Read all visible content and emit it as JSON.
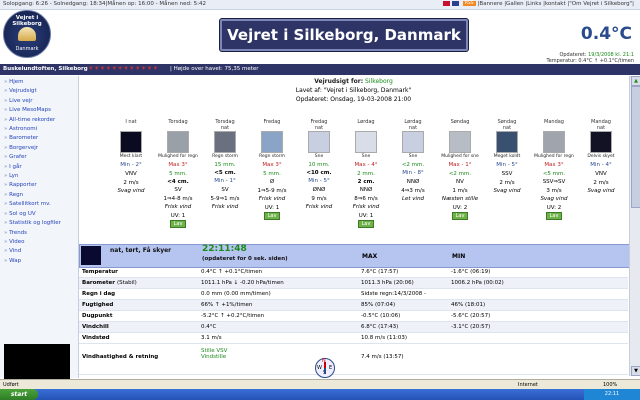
{
  "topstrip": {
    "left_text": "Solopgang: 6:26 - Solnedgang: 18:34|Månen op: 16:00 - Månen ned: 5:42",
    "rss_label": "RSS",
    "links": "|Bannere |Gallen |Links |kontakt  |\"Om Vejret i Silkeborg\"|"
  },
  "header": {
    "logo_top": "Vejret i Silkeborg",
    "logo_bottom": "Danmark",
    "title": "Vejret i Silkeborg, Danmark",
    "big_temp": "0.4°C",
    "updated_line1_pre": "Opdateret: ",
    "updated_line1": "19/3/2008 kl. 21:1",
    "updated_line2": "Temperatur: 0.4°C ↑ +0.1°C/timen"
  },
  "locbar": {
    "name": "Buskelundtoften, Silkeborg",
    "dots": "☀☀☀☀☀☀☀☀☀☀☀☀",
    "altitude": "| Højde over havet: 75,35 meter"
  },
  "sidebar": {
    "items": [
      "Hjem",
      "Vejrudsigt",
      "Live vejr",
      "Live MesoMaps",
      "All-time rekorder",
      "Astronomi",
      "Barometer",
      "Borgervejr",
      "Grafer",
      "I går",
      "Lyn",
      "Rapporter",
      "Regn",
      "Satellitkort mv.",
      "Sol og UV",
      "Statistik og logfiler",
      "Trends",
      "Video",
      "Vind",
      "Wap"
    ]
  },
  "forecast": {
    "title_prefix": "Vejrudsigt for:",
    "title_place": "Silkeborg",
    "made_by": "Lavet af: \"Vejret i Silkeborg, Danmark\"",
    "updated": "Opdateret: Onsdag, 19-03-2008 21:00",
    "days": [
      {
        "day": "I nat",
        "desc": "Mest klart",
        "max": "",
        "mm": "",
        "snow": "",
        "min": "Min - 2°",
        "wind_dir": "VNV",
        "wind_speed": "2 m/s",
        "wind_text": "Svag vind",
        "uv": "",
        "uv_level": ""
      },
      {
        "day": "Torsdag",
        "desc": "Mulighed for regn",
        "max": "Max 3°",
        "mm": "5 mm.",
        "snow": "<4 cm.",
        "min": "",
        "wind_dir": "SV",
        "wind_speed": "1⇒4-8 m/s",
        "wind_text": "Frisk vind",
        "uv": "UV: 1",
        "uv_level": "Lav"
      },
      {
        "day": "Torsdag\nnat",
        "desc": "Regn storm",
        "max": "",
        "mm": "15 mm.",
        "snow": "<5 cm.",
        "min": "Min - 1°",
        "wind_dir": "SV",
        "wind_speed": "5-9⇒1 m/s",
        "wind_text": "Frisk vind",
        "uv": "",
        "uv_level": ""
      },
      {
        "day": "Fredag",
        "desc": "Regn storm",
        "max": "Max 3°",
        "mm": "5 mm.",
        "snow": "",
        "min": "",
        "wind_dir": "Ø",
        "wind_speed": "1⇒5-9 m/s",
        "wind_text": "Frisk vind",
        "uv": "UV: 1",
        "uv_level": "Lav"
      },
      {
        "day": "Fredag\nnat",
        "desc": "Sne",
        "max": "",
        "mm": "10 mm.",
        "snow": "<10 cm.",
        "min": "Min - 5°",
        "wind_dir": "ØNØ",
        "wind_speed": "9 m/s",
        "wind_text": "Frisk vind",
        "uv": "",
        "uv_level": ""
      },
      {
        "day": "Lørdag",
        "desc": "Sne",
        "max": "Max - 4°",
        "mm": "2 mm.",
        "snow": "2 cm.",
        "min": "",
        "wind_dir": "NNØ",
        "wind_speed": "8⇒6 m/s",
        "wind_text": "Frisk vind",
        "uv": "UV: 1",
        "uv_level": "Lav"
      },
      {
        "day": "Lørdag\nnat",
        "desc": "Sne",
        "max": "",
        "mm": "<2 mm.",
        "snow": "",
        "min": "Min - 8°",
        "wind_dir": "NNØ",
        "wind_speed": "4⇒3 m/s",
        "wind_text": "Let vind",
        "uv": "",
        "uv_level": ""
      },
      {
        "day": "Søndag",
        "desc": "Mulighed for sne",
        "max": "Max - 1°",
        "mm": "<2 mm.",
        "snow": "",
        "min": "",
        "wind_dir": "NV",
        "wind_speed": "1 m/s",
        "wind_text": "Næsten stille",
        "uv": "UV: 2",
        "uv_level": "Lav"
      },
      {
        "day": "Søndag\nnat",
        "desc": "Meget koldt",
        "max": "",
        "mm": "",
        "snow": "",
        "min": "Min - 5°",
        "wind_dir": "SSV",
        "wind_speed": "2 m/s",
        "wind_text": "Svag vind",
        "uv": "",
        "uv_level": ""
      },
      {
        "day": "Mandag",
        "desc": "Mulighed for regn",
        "max": "Max 3°",
        "mm": "<5 mm.",
        "snow": "",
        "min": "",
        "wind_dir": "SSV⇒SV",
        "wind_speed": "3 m/s",
        "wind_text": "Svag vind",
        "uv": "UV: 2",
        "uv_level": "Lav"
      },
      {
        "day": "Mandag\nnat",
        "desc": "Delvis skyet",
        "max": "",
        "mm": "",
        "snow": "",
        "min": "Min - 4°",
        "wind_dir": "VNV",
        "wind_speed": "2 m/s",
        "wind_text": "Svag vind",
        "uv": "",
        "uv_level": ""
      }
    ]
  },
  "current": {
    "desc": "nat, tørt, Få skyer",
    "time": "22:11:48",
    "upd": "(opdateret for 0 sek. siden)",
    "max_label": "MAX",
    "min_label": "MIN",
    "rows": [
      {
        "label": "Temperatur",
        "now": "0.4°C ↑ +0.1°C/timen",
        "max": "7.6°C (17:57)",
        "min": "-1.6°C (06:19)"
      },
      {
        "label": "Barometer",
        "label_note": "(Stabil)",
        "now": "1011.1 hPa ↓ -0.20 hPa/timen",
        "max": "1011.3 hPa (20:06)",
        "min": "1006.2 hPa (00:02)"
      },
      {
        "label": "Regn i dag",
        "now": "0.0 mm (0.00 mm/timen)",
        "max": "Sidste regn:14/3/2008 -",
        "min": ""
      },
      {
        "label": "Fugtighed",
        "now": "66% ↑ +1%/timen",
        "max": "85% (07:04)",
        "min": "46% (18:01)"
      },
      {
        "label": "Dugpunkt",
        "now": "-5.2°C ↑ +0.2°C/timen",
        "max": "-0.5°C (10:06)",
        "min": "-5.6°C (20:57)"
      },
      {
        "label": "Vindchill",
        "now": "0.4°C",
        "max": "6.8°C (17:43)",
        "min": "-3.1°C (20:57)"
      },
      {
        "label": "Vindstød",
        "now": "3.1 m/s",
        "max": "10.8 m/s (11:03)",
        "min": ""
      }
    ],
    "wind_label": "Vindhastighed & retning",
    "wind_now1": "Stille  VSV",
    "wind_now2": "Vindstille",
    "wind_max": "7.4 m/s (13:57)"
  },
  "statusbar": {
    "left": "Udført",
    "right": "Internet",
    "zoom": "100%"
  },
  "taskbar": {
    "start": "start",
    "clock": "22:11"
  },
  "colors": {
    "header_navy": "#2e3566",
    "nowbar_blue": "#b6c4f0",
    "link_blue": "#2644b8",
    "max_red": "#c02020",
    "mm_green": "#1a8a1a",
    "lav_green": "#6fb24a"
  }
}
